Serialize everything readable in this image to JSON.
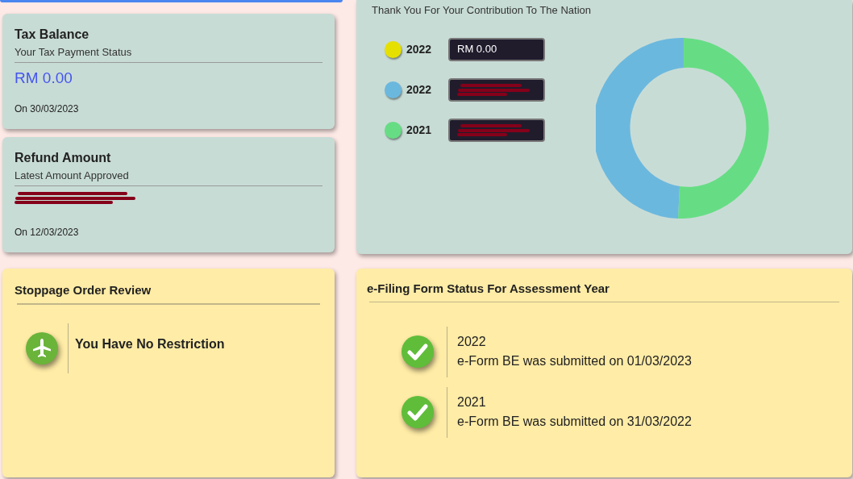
{
  "tax_balance": {
    "title": "Tax Balance",
    "subtitle": "Your Tax Payment Status",
    "amount": "RM 0.00",
    "date": "On 30/03/2023"
  },
  "refund": {
    "title": "Refund Amount",
    "subtitle": "Latest Amount Approved",
    "redacted": true,
    "date": "On 12/03/2023"
  },
  "contribution": {
    "title": "Thank You For Your Contribution To The Nation",
    "legend": [
      {
        "year": "2022",
        "color": "#e6e000",
        "value": "RM 0.00",
        "redacted": false
      },
      {
        "year": "2022",
        "color": "#6bb8de",
        "redacted": true
      },
      {
        "year": "2021",
        "color": "#66dd84",
        "redacted": true
      }
    ]
  },
  "stoppage": {
    "title": "Stoppage Order Review",
    "message": "You Have No Restriction"
  },
  "efiling": {
    "title": "e-Filing Form Status For Assessment Year",
    "items": [
      {
        "year": "2022",
        "text": "e-Form BE was submitted on 01/03/2023",
        "submitted": true
      },
      {
        "year": "2021",
        "text": "e-Form BE was submitted on 31/03/2022",
        "submitted": true
      }
    ]
  }
}
